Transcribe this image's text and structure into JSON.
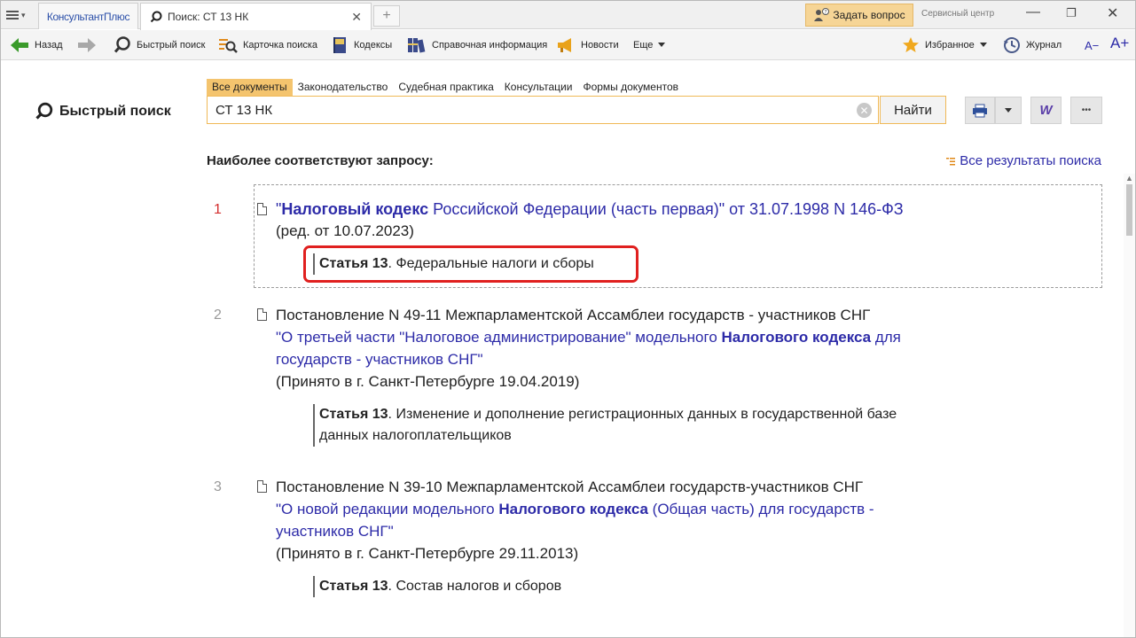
{
  "tabs": {
    "menu_arrow": "▾",
    "brand": "КонсультантПлюс",
    "search_tab": "Поиск: СТ 13 НК",
    "close": "✕",
    "new_tab": "+"
  },
  "header": {
    "ask": "Задать вопрос",
    "service": "Сервисный центр"
  },
  "window_controls": {
    "minimize": "—",
    "maximize": "❐",
    "close": "✕"
  },
  "toolbar": {
    "back": "Назад",
    "quick_search": "Быстрый поиск",
    "card_search": "Карточка поиска",
    "codes": "Кодексы",
    "reference": "Справочная информация",
    "news": "Новости",
    "more": "Еще",
    "favorites": "Избранное",
    "journal": "Журнал",
    "font_smaller": "A−",
    "font_larger": "A+"
  },
  "page": {
    "title": "Быстрый поиск",
    "filters": [
      "Все документы",
      "Законодательство",
      "Судебная практика",
      "Консультации",
      "Формы документов"
    ],
    "query": "СТ 13 НК",
    "find": "Найти",
    "word_btn": "W",
    "more_btn": "•••",
    "best_heading": "Наиболее соответствуют запросу:",
    "all_results": "Все результаты поиска"
  },
  "results": [
    {
      "num": "1",
      "title_quote_open": "\"",
      "title_bold": "Налоговый кодекс",
      "title_rest": " Российской Федерации (часть первая)\" от 31.07.1998 N 146-ФЗ",
      "edition": "(ред. от 10.07.2023)",
      "article_bold": "Статья 13",
      "article_text": ". Федеральные налоги и сборы"
    },
    {
      "num": "2",
      "line1": "Постановление N 49-11 Межпарламентской Ассамблеи государств - участников СНГ",
      "line2_a": "\"О третьей части \"Налоговое администрирование\" модельного ",
      "line2_bold": "Налогового кодекса",
      "line2_c": " для",
      "line3": "государств - участников СНГ\"",
      "line4": "(Принято в г. Санкт-Петербурге 19.04.2019)",
      "article_bold": "Статья 13",
      "article_text1": ". Изменение и дополнение регистрационных данных в государственной базе",
      "article_text2": "данных налогоплательщиков"
    },
    {
      "num": "3",
      "line1": "Постановление N 39-10 Межпарламентской Ассамблеи государств-участников СНГ",
      "line2_a": "\"О новой редакции модельного ",
      "line2_bold": "Налогового кодекса",
      "line2_c": " (Общая часть) для государств -",
      "line3": "участников СНГ\"",
      "line4": "(Принято в г. Санкт-Петербурге 29.11.2013)",
      "article_bold": "Статья 13",
      "article_text": ". Состав налогов и сборов"
    }
  ],
  "colors": {
    "accent": "#f4c46e",
    "link": "#2d2ba8",
    "highlight": "#e0201f",
    "green": "#3a9a2a"
  }
}
